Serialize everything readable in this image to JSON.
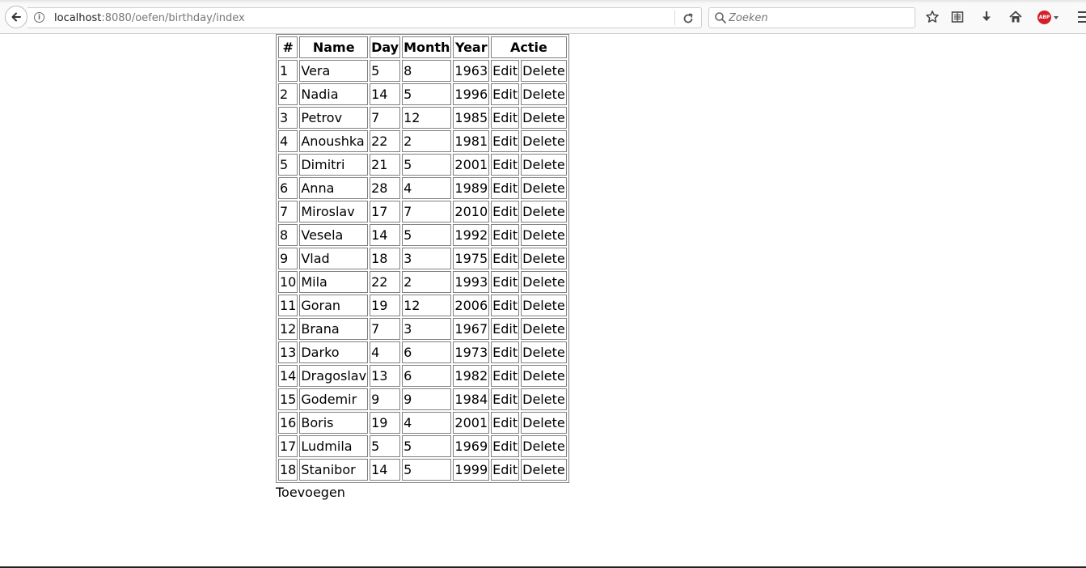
{
  "browser": {
    "url_host": "localhost",
    "url_rest": ":8080/oefen/birthday/index",
    "search_placeholder": "Zoeken",
    "abp_label": "ABP"
  },
  "table": {
    "headers": {
      "num": "#",
      "name": "Name",
      "day": "Day",
      "month": "Month",
      "year": "Year",
      "actie": "Actie"
    },
    "edit_label": "Edit",
    "delete_label": "Delete",
    "rows": [
      {
        "num": "1",
        "name": "Vera",
        "day": "5",
        "month": "8",
        "year": "1963"
      },
      {
        "num": "2",
        "name": "Nadia",
        "day": "14",
        "month": "5",
        "year": "1996"
      },
      {
        "num": "3",
        "name": "Petrov",
        "day": "7",
        "month": "12",
        "year": "1985"
      },
      {
        "num": "4",
        "name": "Anoushka",
        "day": "22",
        "month": "2",
        "year": "1981"
      },
      {
        "num": "5",
        "name": "Dimitri",
        "day": "21",
        "month": "5",
        "year": "2001"
      },
      {
        "num": "6",
        "name": "Anna",
        "day": "28",
        "month": "4",
        "year": "1989"
      },
      {
        "num": "7",
        "name": "Miroslav",
        "day": "17",
        "month": "7",
        "year": "2010"
      },
      {
        "num": "8",
        "name": "Vesela",
        "day": "14",
        "month": "5",
        "year": "1992"
      },
      {
        "num": "9",
        "name": "Vlad",
        "day": "18",
        "month": "3",
        "year": "1975"
      },
      {
        "num": "10",
        "name": "Mila",
        "day": "22",
        "month": "2",
        "year": "1993"
      },
      {
        "num": "11",
        "name": "Goran",
        "day": "19",
        "month": "12",
        "year": "2006"
      },
      {
        "num": "12",
        "name": "Brana",
        "day": "7",
        "month": "3",
        "year": "1967"
      },
      {
        "num": "13",
        "name": "Darko",
        "day": "4",
        "month": "6",
        "year": "1973"
      },
      {
        "num": "14",
        "name": "Dragoslav",
        "day": "13",
        "month": "6",
        "year": "1982"
      },
      {
        "num": "15",
        "name": "Godemir",
        "day": "9",
        "month": "9",
        "year": "1984"
      },
      {
        "num": "16",
        "name": "Boris",
        "day": "19",
        "month": "4",
        "year": "2001"
      },
      {
        "num": "17",
        "name": "Ludmila",
        "day": "5",
        "month": "5",
        "year": "1969"
      },
      {
        "num": "18",
        "name": "Stanibor",
        "day": "14",
        "month": "5",
        "year": "1999"
      }
    ]
  },
  "add_link_label": "Toevoegen"
}
